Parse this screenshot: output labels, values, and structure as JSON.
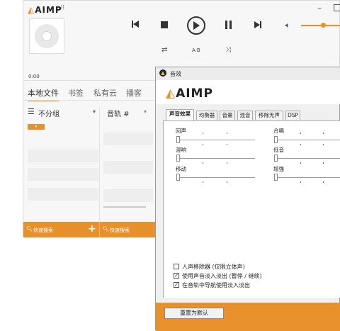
{
  "main": {
    "logo": "AIMP",
    "time": "0:00",
    "controls": {
      "ab_label": "A-B"
    },
    "tabs": [
      {
        "label": "本地文件"
      },
      {
        "label": "书签"
      },
      {
        "label": "私有云"
      },
      {
        "label": "播客"
      }
    ],
    "group_label": "不分组",
    "track_column": "音轨 #",
    "search_left": "快速搜索",
    "search_right": "快速搜索",
    "accent": "#e8902b"
  },
  "dialog": {
    "title": "音效",
    "logo": "AIMP",
    "tabs": [
      {
        "label": "声音效果"
      },
      {
        "label": "均衡器"
      },
      {
        "label": "音量"
      },
      {
        "label": "混音"
      },
      {
        "label": "移除无声"
      },
      {
        "label": "DSP"
      }
    ],
    "sliders": [
      {
        "label": "回声"
      },
      {
        "label": "合唱"
      },
      {
        "label": "混响"
      },
      {
        "label": "低音"
      },
      {
        "label": "移动"
      },
      {
        "label": "增强"
      }
    ],
    "checkboxes": [
      {
        "label": "人声移除器 (仅限立体声)",
        "checked": false
      },
      {
        "label": "使用声音淡入淡出 (暂停 / 继续)",
        "checked": true
      },
      {
        "label": "在音轨中导航使用淡入淡出",
        "checked": true
      }
    ],
    "reset_button": "重置为默认"
  }
}
